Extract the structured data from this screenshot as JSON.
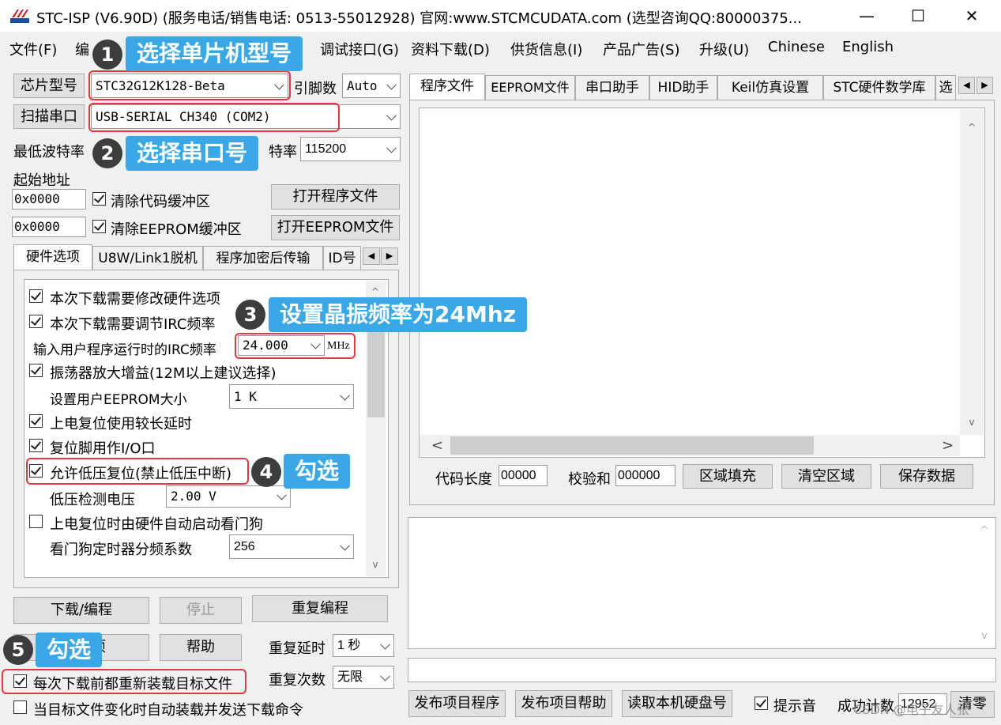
{
  "window": {
    "title": "STC-ISP (V6.90D) (服务电话/销售电话: 0513-55012928) 官网:www.STCMCUDATA.com  (选型咨询QQ:80000375...",
    "min": "—",
    "max": "☐",
    "close": "✕"
  },
  "menu": [
    "文件(F)",
    "编",
    "调试接口(G)",
    "资料下载(D)",
    "供货信息(I)",
    "产品广告(S)",
    "升级(U)",
    "Chinese",
    "English"
  ],
  "left": {
    "chip_btn": "芯片型号",
    "chip_value": "STC32G12K128-Beta",
    "pins_label": "引脚数",
    "pins_value": "Auto",
    "scan_btn": "扫描串口",
    "port_value": "USB-SERIAL CH340 (COM2)",
    "minbaud_label": "最低波特率",
    "maxbaud_label_tail": "特率",
    "maxbaud_value": "115200",
    "start_addr_label": "起始地址",
    "addr1": "0x0000",
    "clear_code": "清除代码缓冲区",
    "open_prog_btn": "打开程序文件",
    "addr2": "0x0000",
    "clear_eeprom": "清除EEPROM缓冲区",
    "open_eeprom_btn": "打开EEPROM文件",
    "tabs": [
      "硬件选项",
      "U8W/Link1脱机",
      "程序加密后传输",
      "ID号"
    ],
    "options": {
      "opt1": "本次下载需要修改硬件选项",
      "opt2": "本次下载需要调节IRC频率",
      "irc_label": "输入用户程序运行时的IRC频率",
      "irc_value": "24.000",
      "irc_unit": "MHz",
      "opt3": "振荡器放大增益(12M以上建议选择)",
      "eeprom_size_label": "设置用户EEPROM大小",
      "eeprom_size_value": "1    K",
      "opt4": "上电复位使用较长延时",
      "opt5": "复位脚用作I/O口",
      "opt6": "允许低压复位(禁止低压中断)",
      "lvd_label": "低压检测电压",
      "lvd_value": "2.00 V",
      "opt7": "上电复位时由硬件自动启动看门狗",
      "wdt_label": "看门狗定时器分频系数",
      "wdt_value": "256"
    },
    "download_btn": "下载/编程",
    "stop_btn": "停止",
    "reprogram_btn": "重复编程",
    "options_btn_tail": "选项",
    "help_btn": "帮助",
    "repeat_delay_label": "重复延时",
    "repeat_delay_value": "1 秒",
    "repeat_count_label": "重复次数",
    "repeat_count_value": "无限",
    "reload_each": "每次下载前都重新装载目标文件",
    "auto_reload": "当目标文件变化时自动装载并发送下载命令"
  },
  "right": {
    "tabs": [
      "程序文件",
      "EEPROM文件",
      "串口助手",
      "HID助手",
      "Keil仿真设置",
      "STC硬件数学库",
      "选"
    ],
    "code_len_label": "代码长度",
    "code_len_value": "00000",
    "checksum_label": "校验和",
    "checksum_value": "000000",
    "fill_btn": "区域填充",
    "clear_btn": "清空区域",
    "save_btn": "保存数据",
    "publish_prog_btn": "发布项目程序",
    "publish_help_btn": "发布项目帮助",
    "read_disk_btn": "读取本机硬盘号",
    "beep_label": "提示音",
    "success_label": "成功计数",
    "success_value": "12952",
    "clear_count_btn": "清零",
    "watermark": "CSDN @电子友人张"
  },
  "annotations": [
    {
      "num": "1",
      "text": "选择单片机型号"
    },
    {
      "num": "2",
      "text": "选择串口号"
    },
    {
      "num": "3",
      "text": "设置晶振频率为24Mhz"
    },
    {
      "num": "4",
      "text": "勾选"
    },
    {
      "num": "5",
      "text": "勾选"
    }
  ],
  "colors": {
    "highlight": "#e2383f",
    "badge": "#3aa7e6",
    "number": "#3d3d3d"
  }
}
